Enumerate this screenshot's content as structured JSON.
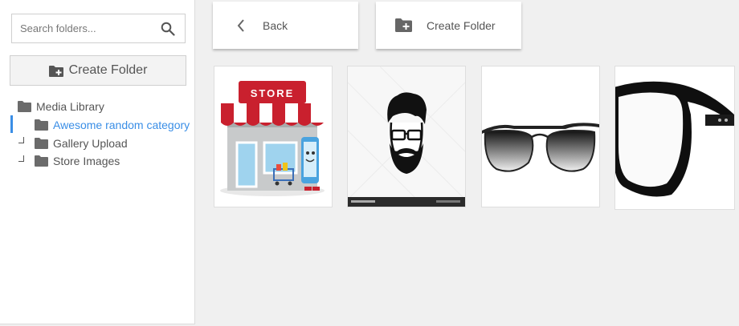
{
  "sidebar": {
    "search": {
      "placeholder": "Search folders..."
    },
    "create_button_label": "Create Folder",
    "tree": [
      {
        "label": "Media Library",
        "level": 0,
        "active": false
      },
      {
        "label": "Awesome random category",
        "level": 1,
        "active": true
      },
      {
        "label": "Gallery Upload",
        "level": 1,
        "active": false
      },
      {
        "label": "Store Images",
        "level": 1,
        "active": false
      }
    ]
  },
  "toolbar": {
    "back_label": "Back",
    "create_folder_label": "Create Folder"
  },
  "media": [
    {
      "name": "store-image",
      "sign_text": "STORE"
    },
    {
      "name": "hipster-face-image"
    },
    {
      "name": "aviator-sunglasses-image"
    },
    {
      "name": "black-glasses-image"
    }
  ],
  "colors": {
    "accent": "#3a8ee6",
    "folder_icon": "#6b6b6b"
  }
}
